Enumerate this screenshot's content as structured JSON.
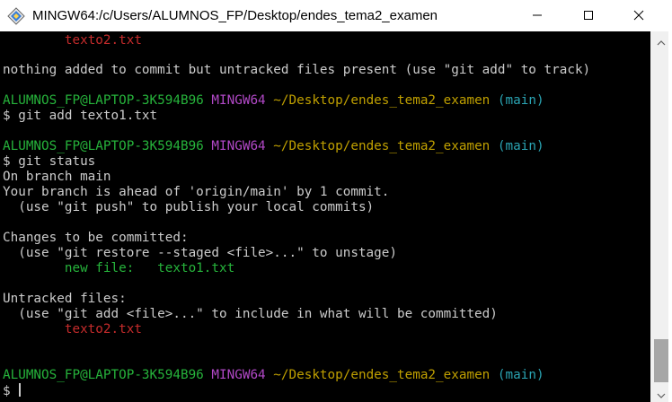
{
  "window": {
    "title": "MINGW64:/c/Users/ALUMNOS_FP/Desktop/endes_tema2_examen",
    "icons": [
      "mingw-icon",
      "minimize-icon",
      "maximize-icon",
      "close-icon"
    ]
  },
  "terminal": {
    "colors": {
      "background": "#000000",
      "text": "#c0c0c0",
      "user": "#26b33b",
      "shell": "#b148c6",
      "path": "#c0a000",
      "branch": "#2aa4b3",
      "untracked": "#c42b2b",
      "staged": "#26b33b"
    },
    "untracked_top": "texto2.txt",
    "nothing_added": "nothing added to commit but untracked files present (use \"git add\" to track)",
    "prompt1": {
      "user": "ALUMNOS_FP@LAPTOP-3K594B96",
      "shell": "MINGW64",
      "path": "~/Desktop/endes_tema2_examen",
      "branch": "(main)"
    },
    "command1": "$ git add texto1.txt",
    "prompt2": {
      "user": "ALUMNOS_FP@LAPTOP-3K594B96",
      "shell": "MINGW64",
      "path": "~/Desktop/endes_tema2_examen",
      "branch": "(main)"
    },
    "command2": "$ git status",
    "on_branch": "On branch main",
    "ahead": "Your branch is ahead of 'origin/main' by 1 commit.",
    "push_hint": "  (use \"git push\" to publish your local commits)",
    "changes_header": "Changes to be committed:",
    "restore_hint": "  (use \"git restore --staged <file>...\" to unstage)",
    "new_file": "        new file:   texto1.txt",
    "untracked_header": "Untracked files:",
    "add_hint": "  (use \"git add <file>...\" to include in what will be committed)",
    "untracked_file": "        texto2.txt",
    "prompt3": {
      "user": "ALUMNOS_FP@LAPTOP-3K594B96",
      "shell": "MINGW64",
      "path": "~/Desktop/endes_tema2_examen",
      "branch": "(main)"
    },
    "command3": "$ "
  }
}
